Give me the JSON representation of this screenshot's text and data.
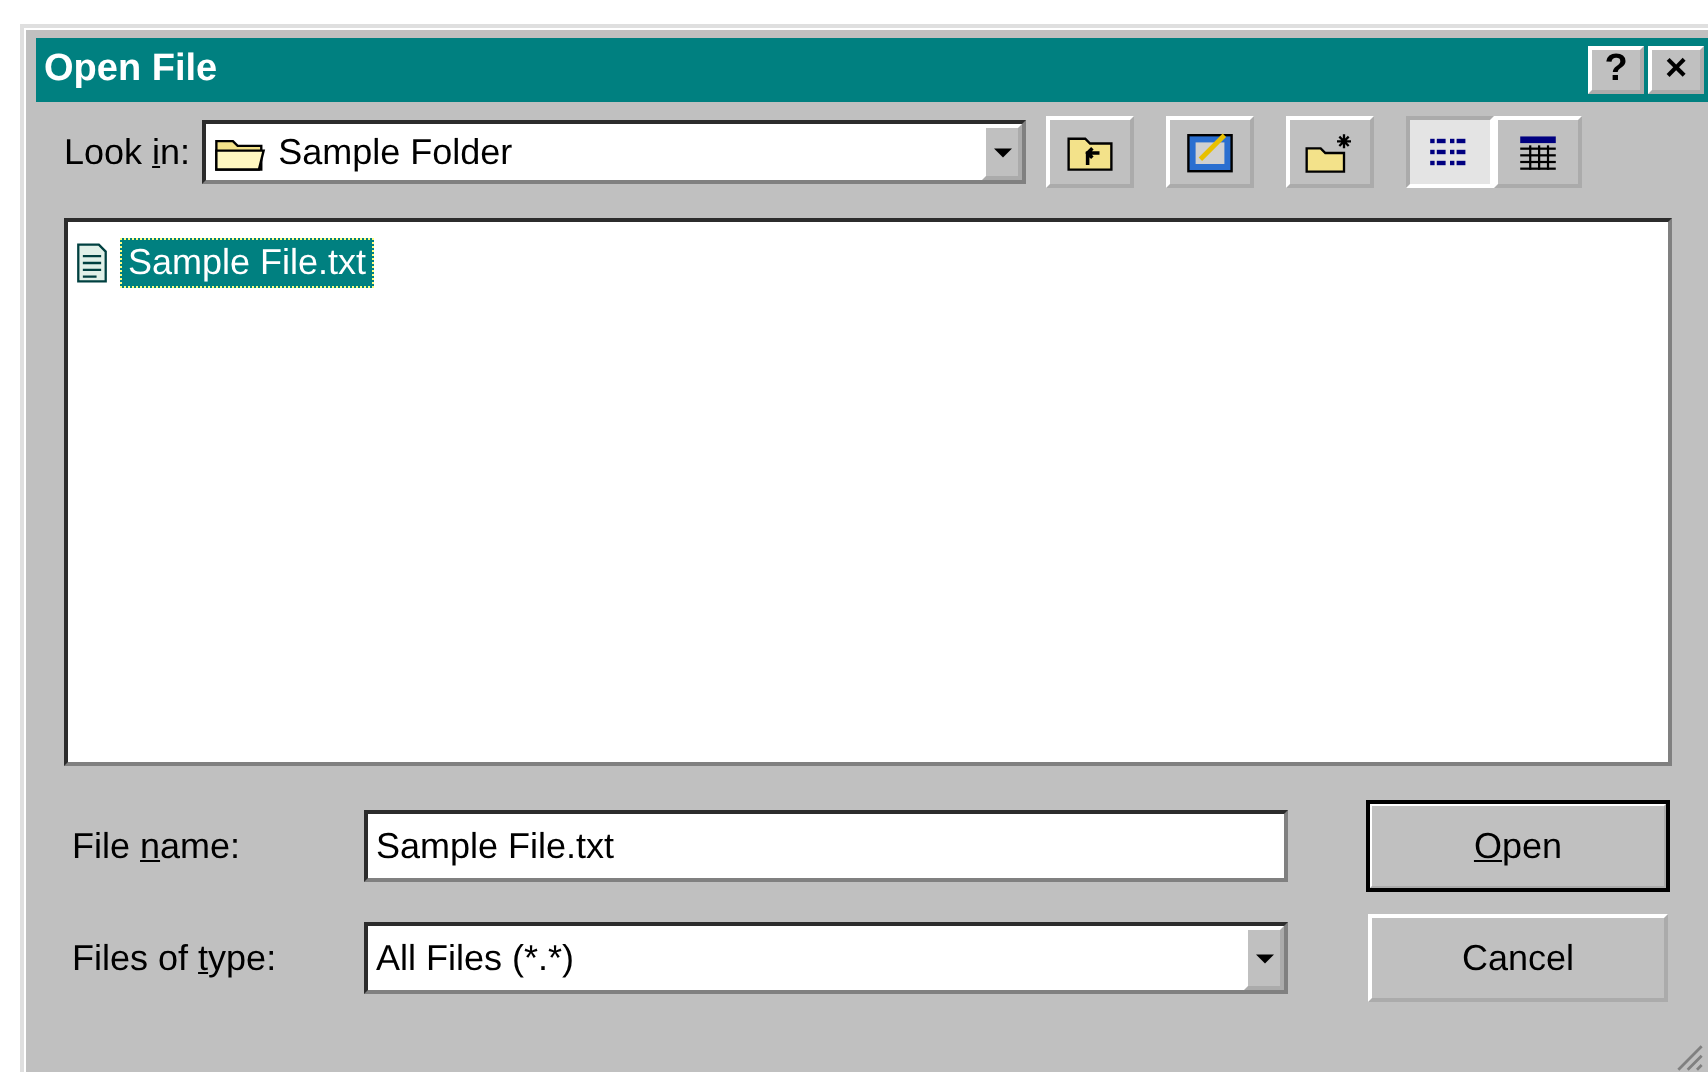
{
  "window": {
    "title": "Open File",
    "help_button": "?",
    "close_button": "×"
  },
  "look_in": {
    "label": {
      "before": "Look ",
      "key": "i",
      "after": "n:"
    },
    "value": "Sample Folder"
  },
  "toolbar": [
    {
      "kind": "up",
      "selected": false
    },
    {
      "kind": "desktop",
      "selected": false
    },
    {
      "kind": "new-folder",
      "selected": false
    },
    {
      "kind": "list",
      "selected": true
    },
    {
      "kind": "details",
      "selected": false
    }
  ],
  "files": [
    {
      "name": "Sample File.txt",
      "selected": true
    }
  ],
  "file_name": {
    "label": {
      "before": "File ",
      "key": "n",
      "after": "ame:"
    },
    "value": "Sample File.txt"
  },
  "file_type": {
    "label": {
      "before": "Files of ",
      "key": "t",
      "after": "ype:"
    },
    "value": "All Files (*.*)"
  },
  "buttons": [
    {
      "label": {
        "key": "O",
        "after": "pen"
      },
      "default": true
    },
    {
      "label": {
        "before": "Cancel"
      },
      "default": false
    }
  ]
}
